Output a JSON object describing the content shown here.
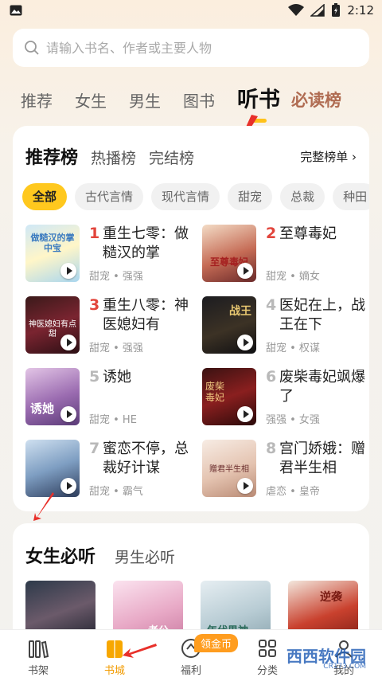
{
  "status_bar": {
    "time": "2:12"
  },
  "search": {
    "placeholder": "请输入书名、作者或主要人物"
  },
  "categories": [
    "推荐",
    "女生",
    "男生",
    "图书",
    "听书",
    "必读榜"
  ],
  "active_category": "听书",
  "ranking": {
    "tabs": [
      "推荐榜",
      "热播榜",
      "完结榜"
    ],
    "full_list_label": "完整榜单",
    "chips": [
      "全部",
      "古代言情",
      "现代言情",
      "甜宠",
      "总裁",
      "种田"
    ],
    "items": [
      {
        "rank": "1",
        "title": "重生七零：做糙汉的掌",
        "tags": "甜宠 • 强强",
        "cover_text": "做糙汉的掌中宝"
      },
      {
        "rank": "2",
        "title": "至尊毒妃",
        "tags": "甜宠 • 嫡女",
        "cover_text": "至尊毒妃"
      },
      {
        "rank": "3",
        "title": "重生八零：神医媳妇有",
        "tags": "甜宠 • 强强",
        "cover_text": "神医媳妇有点甜"
      },
      {
        "rank": "4",
        "title": "医妃在上，战王在下",
        "tags": "甜宠 • 权谋",
        "cover_text": "战王"
      },
      {
        "rank": "5",
        "title": "诱她",
        "tags": "甜宠 • HE",
        "cover_text": "诱她"
      },
      {
        "rank": "6",
        "title": "废柴毒妃飒爆了",
        "tags": "强强 • 女强",
        "cover_text": "废柴毒妃"
      },
      {
        "rank": "7",
        "title": "蜜恋不停，总裁好计谋",
        "tags": "甜宠 • 霸气",
        "cover_text": ""
      },
      {
        "rank": "8",
        "title": "宫门娇娥：赠君半生相",
        "tags": "虐恋 • 皇帝",
        "cover_text": "赠君半生相"
      }
    ]
  },
  "must_listen": {
    "tabs": [
      "女生必听",
      "男生必听"
    ],
    "covers": [
      "",
      "老公",
      "年代男神",
      "逆袭"
    ]
  },
  "bottom_nav": [
    {
      "label": "书架"
    },
    {
      "label": "书城"
    },
    {
      "label": "福利"
    },
    {
      "label": "分类"
    },
    {
      "label": "我的"
    }
  ],
  "welfare_badge": "领金币",
  "watermark": "西西软件园",
  "watermark_sub": "CR173.COM",
  "colors": {
    "accent": "#ffc81e",
    "rank_top": "#e2453c",
    "rank_rest": "#b9b9b9",
    "annotation_arrow": "#e8302a"
  }
}
